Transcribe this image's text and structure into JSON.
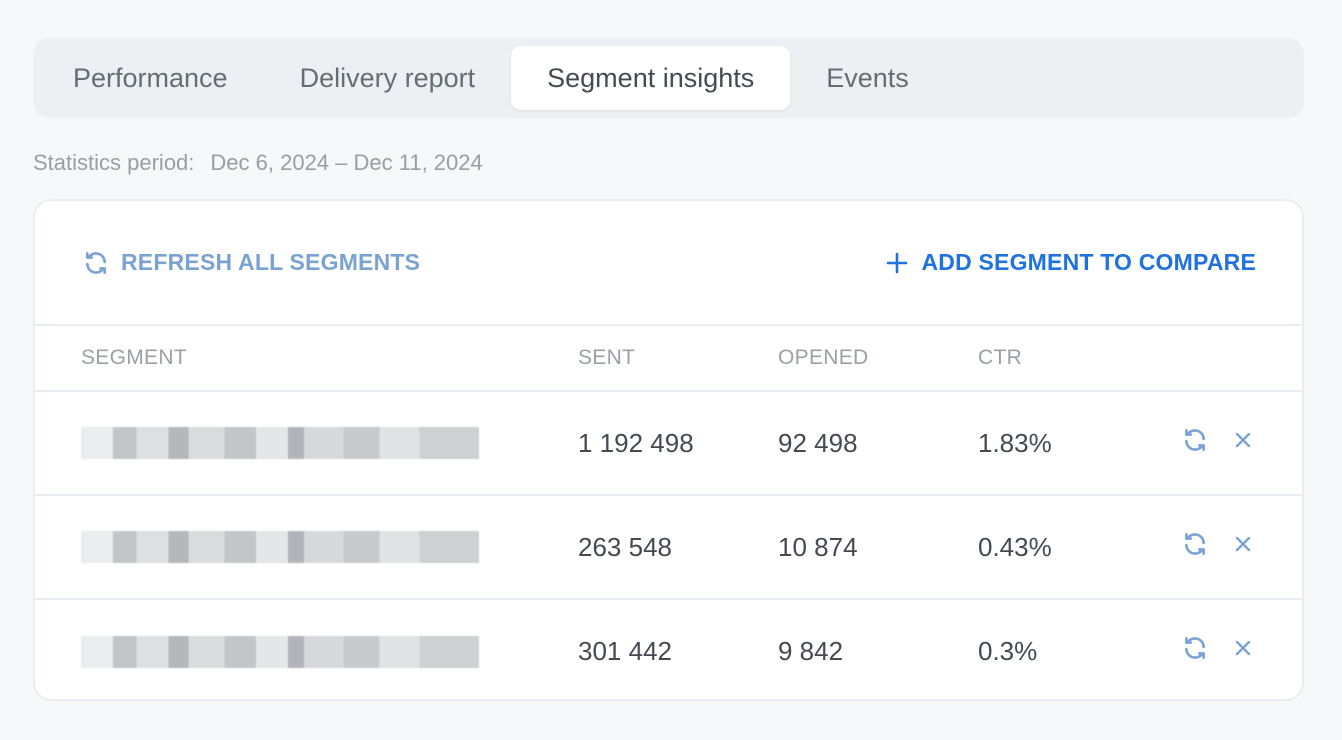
{
  "tabs": [
    {
      "label": "Performance",
      "active": false
    },
    {
      "label": "Delivery report",
      "active": false
    },
    {
      "label": "Segment insights",
      "active": true
    },
    {
      "label": "Events",
      "active": false
    }
  ],
  "period": {
    "label": "Statistics period:",
    "value": "Dec 6, 2024 – Dec 11, 2024"
  },
  "toolbar": {
    "refresh_label": "REFRESH ALL SEGMENTS",
    "refresh_icon": "refresh-icon",
    "add_label": "ADD SEGMENT TO COMPARE",
    "add_icon": "plus-icon"
  },
  "table": {
    "columns": [
      "SEGMENT",
      "SENT",
      "OPENED",
      "CTR"
    ],
    "rows": [
      {
        "segment": "[redacted]",
        "sent": "1 192 498",
        "opened": "92 498",
        "ctr": "1.83%"
      },
      {
        "segment": "[redacted]",
        "sent": "263 548",
        "opened": "10 874",
        "ctr": "0.43%"
      },
      {
        "segment": "[redacted]",
        "sent": "301 442",
        "opened": "9 842",
        "ctr": "0.3%"
      }
    ],
    "row_actions": [
      "refresh-icon",
      "close-icon"
    ]
  },
  "colors": {
    "accent": "#1f72e0",
    "refresh_muted": "#7aa3d3",
    "action_icon": "#7aa3d3"
  }
}
